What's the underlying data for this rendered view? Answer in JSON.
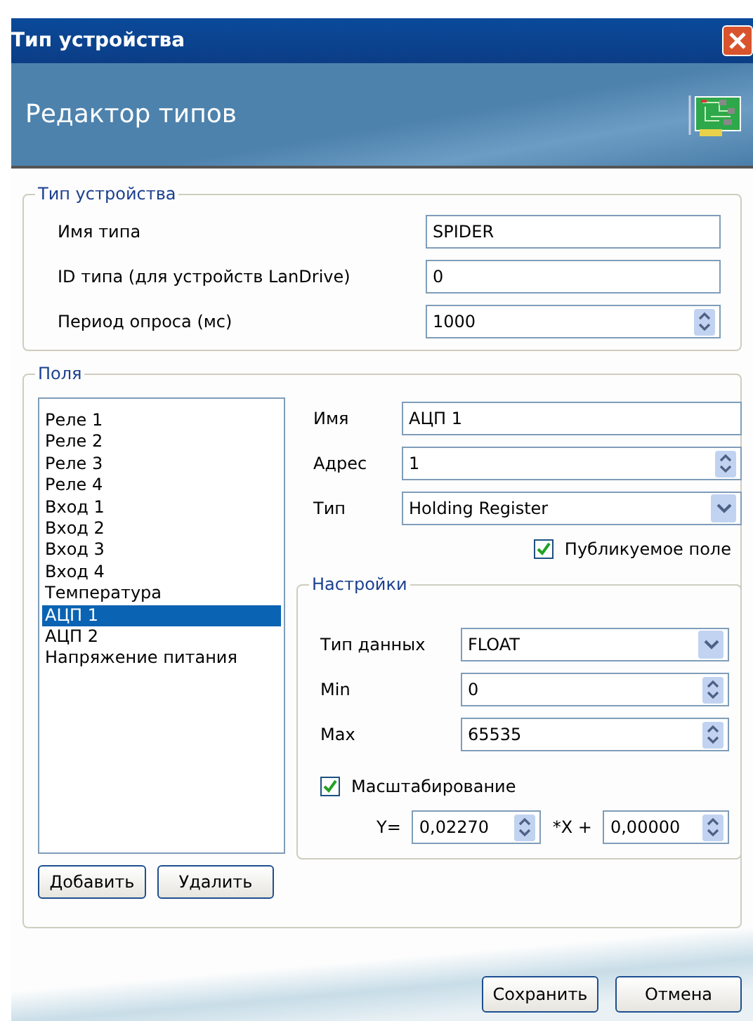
{
  "window": {
    "title": "Тип устройства"
  },
  "header": {
    "title": "Редактор типов"
  },
  "device_group": {
    "title": "Тип устройства",
    "fields": [
      {
        "label": "Имя типа",
        "value": "SPIDER",
        "kind": "text"
      },
      {
        "label": "ID типа (для устройств LanDrive)",
        "value": "0",
        "kind": "text"
      },
      {
        "label": "Период опроса (мс)",
        "value": "1000",
        "kind": "spin"
      }
    ]
  },
  "fields_group": {
    "title": "Поля",
    "list": [
      {
        "label": "Реле 1",
        "selected": false
      },
      {
        "label": "Реле 2",
        "selected": false
      },
      {
        "label": "Реле 3",
        "selected": false
      },
      {
        "label": "Реле 4",
        "selected": false
      },
      {
        "label": "Вход 1",
        "selected": false
      },
      {
        "label": "Вход 2",
        "selected": false
      },
      {
        "label": "Вход 3",
        "selected": false
      },
      {
        "label": "Вход 4",
        "selected": false
      },
      {
        "label": "Температура",
        "selected": false
      },
      {
        "label": "АЦП 1",
        "selected": true
      },
      {
        "label": "АЦП 2",
        "selected": false
      },
      {
        "label": "Напряжение питания",
        "selected": false
      }
    ],
    "props": [
      {
        "label": "Имя",
        "value": "АЦП 1",
        "kind": "text"
      },
      {
        "label": "Адрес",
        "value": "1",
        "kind": "spin"
      },
      {
        "label": "Тип",
        "value": "Holding Register",
        "kind": "select"
      }
    ],
    "published": {
      "label": "Публикуемое поле",
      "checked": true
    },
    "settings": {
      "title": "Настройки",
      "props": [
        {
          "label": "Тип данных",
          "value": "FLOAT",
          "kind": "select"
        },
        {
          "label": "Min",
          "value": "0",
          "kind": "spin"
        },
        {
          "label": "Max",
          "value": "65535",
          "kind": "spin"
        }
      ],
      "scaling": {
        "label": "Масштабирование",
        "checked": true
      },
      "formula": {
        "y_label": "Y=",
        "k": "0,02270",
        "x_label": "*X +",
        "b": "0,00000"
      }
    },
    "buttons": [
      "Добавить",
      "Удалить"
    ]
  },
  "footer_buttons": [
    "Сохранить",
    "Отмена"
  ]
}
